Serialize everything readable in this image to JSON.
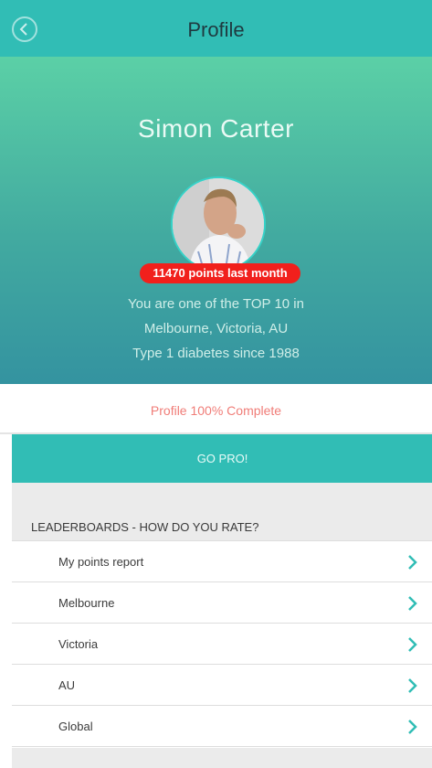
{
  "header": {
    "title": "Profile",
    "back_icon": "back-circle-icon"
  },
  "profile": {
    "name": "Simon Carter",
    "points_badge": "11470 points last month",
    "rank_line": "You are one of the TOP 10 in",
    "location_line": "Melbourne, Victoria, AU",
    "diabetes_line": "Type 1 diabetes since 1988",
    "completion": "Profile 100% Complete"
  },
  "cta": {
    "label": "GO PRO!"
  },
  "leaderboards": {
    "heading": "LEADERBOARDS - HOW DO YOU RATE?",
    "items": [
      {
        "label": "My points report"
      },
      {
        "label": "Melbourne"
      },
      {
        "label": "Victoria"
      },
      {
        "label": "AU"
      },
      {
        "label": "Global"
      }
    ]
  },
  "colors": {
    "header": "#31bdb5",
    "accent": "#31bdb5",
    "badge": "#f1201c",
    "completion_text": "#f07d78",
    "chevron": "#31bdb5"
  }
}
